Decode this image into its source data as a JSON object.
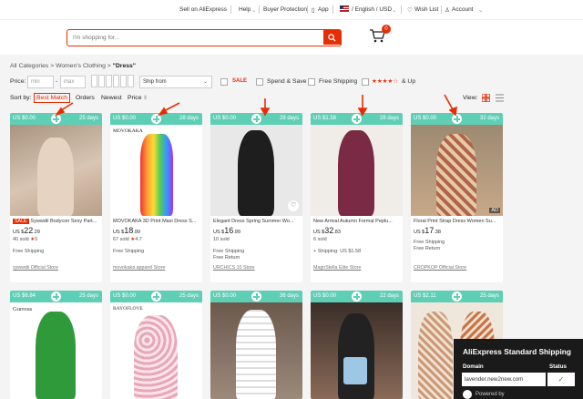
{
  "topbar": {
    "sell": "Sell on AliExpress",
    "help": "Help",
    "buyer_protection": "Buyer Protection",
    "app": "App",
    "lang_currency": "/ English / USD",
    "wishlist": "Wish List",
    "account": "Account"
  },
  "search": {
    "placeholder": "I'm shopping for..."
  },
  "cart": {
    "count": "0"
  },
  "breadcrumb": {
    "all": "All Categories",
    "sep1": ">",
    "cat": "Women's Clothing",
    "sep2": ">",
    "current": "\"Dress\""
  },
  "filters": {
    "price_label": "Price:",
    "min_placeholder": "min",
    "dash": "-",
    "max_placeholder": "max",
    "ship_from": "Ship from",
    "sale": "SALE",
    "spend_save": "Spend & Save",
    "free_shipping": "Free Shipping",
    "stars_up": "& Up",
    "stars": "★★★★☆"
  },
  "sort": {
    "label": "Sort by:",
    "best_match": "Best Match",
    "orders": "Orders",
    "newest": "Newest",
    "price": "Price",
    "view_label": "View:"
  },
  "products_row1": [
    {
      "ship_cost": "US $0.00",
      "days": "25 days",
      "sale_tag": "SALE",
      "title": "Sywwdii Bodycon Sexy Part...",
      "currency": "US $",
      "price_int": "22",
      "price_dec": ".29",
      "sold": "40 sold",
      "rating": "5",
      "free1": "Free Shipping",
      "free2": "",
      "store": "sywwdii Official Store",
      "color": "#c9b3a3"
    },
    {
      "ship_cost": "US $0.00",
      "days": "28 days",
      "sale_tag": "",
      "title": "MOVOKAKA 3D Print Maxi Dress S...",
      "currency": "US $",
      "price_int": "18",
      "price_dec": ".99",
      "sold": "67 sold",
      "rating": "4.7",
      "free1": "Free Shipping",
      "free2": "",
      "store": "movokaka apparel Store",
      "color": "#d98b3a"
    },
    {
      "ship_cost": "US $0.00",
      "days": "28 days",
      "sale_tag": "",
      "title": "Elegant Dress Spring Summer Wo...",
      "currency": "US $",
      "price_int": "16",
      "price_dec": ".99",
      "sold": "10 sold",
      "rating": "",
      "free1": "Free Shipping",
      "free2": "Free Return",
      "store": "URCHICS 10 Store",
      "color": "#3a3a3a"
    },
    {
      "ship_cost": "US $1.58",
      "days": "28 days",
      "sale_tag": "",
      "title": "New Arrival Autumn Formal Peplu...",
      "currency": "US $",
      "price_int": "32",
      "price_dec": ".83",
      "sold": "6 sold",
      "rating": "",
      "free1": "+ Shipping: US $1.58",
      "free2": "",
      "store": "MagnStella Elite Store",
      "color": "#7a2a45"
    },
    {
      "ship_cost": "US $0.00",
      "days": "32 days",
      "sale_tag": "",
      "title": "Floral Print Strap Dress Women Su...",
      "currency": "US $",
      "price_int": "17",
      "price_dec": ".38",
      "sold": "",
      "rating": "",
      "free1": "Free Shipping",
      "free2": "Free Return",
      "store": "CROPKOP Official Store",
      "color": "#b07a5a"
    }
  ],
  "products_row2": [
    {
      "ship_cost": "US $6.84",
      "days": "25 days",
      "color": "#2e9a3a"
    },
    {
      "ship_cost": "US $0.00",
      "days": "25 days",
      "color": "#e7a7b8"
    },
    {
      "ship_cost": "US $0.00",
      "days": "36 days",
      "color": "#d8d8d8"
    },
    {
      "ship_cost": "US $0.00",
      "days": "22 days",
      "color": "#5a4a40"
    },
    {
      "ship_cost": "US $2.11",
      "days": "25 days",
      "color": "#c99a7a"
    }
  ],
  "extension": {
    "title": "AliExpress Standard Shipping",
    "domain_header": "Domain",
    "status_header": "Status",
    "domain_value": "lavender.new2new.com",
    "status_value": "✓",
    "powered_by": "Powered by"
  },
  "colors": {
    "accent": "#e62e04",
    "ship_band": "#5ecfb5",
    "panel": "#1a1a1a"
  }
}
